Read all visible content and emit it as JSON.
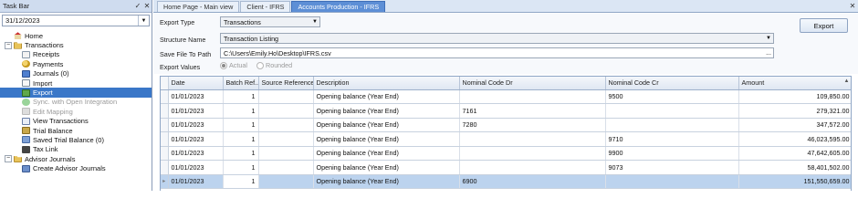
{
  "taskbar": {
    "title": "Task Bar",
    "pin_glyph": "✓",
    "close_glyph": "✕",
    "date_value": "31/12/2023",
    "tree": [
      {
        "label": "Home",
        "level": "l0noexp",
        "icon": "house",
        "expander": "",
        "state": ""
      },
      {
        "label": "Transactions",
        "level": "l0",
        "icon": "folder",
        "expander": "−",
        "state": ""
      },
      {
        "label": "Receipts",
        "level": "l1",
        "icon": "doc",
        "expander": "",
        "state": ""
      },
      {
        "label": "Payments",
        "level": "l1",
        "icon": "coins",
        "expander": "",
        "state": ""
      },
      {
        "label": "Journals (0)",
        "level": "l1",
        "icon": "journal",
        "expander": "",
        "state": ""
      },
      {
        "label": "Import",
        "level": "l1",
        "icon": "import",
        "expander": "",
        "state": ""
      },
      {
        "label": "Export",
        "level": "l1",
        "icon": "export",
        "expander": "",
        "state": "sel"
      },
      {
        "label": "Sync. with Open Integration",
        "level": "l1",
        "icon": "sync",
        "expander": "",
        "state": "dis"
      },
      {
        "label": "Edit Mapping",
        "level": "l1",
        "icon": "edit",
        "expander": "",
        "state": "dis"
      },
      {
        "label": "View Transactions",
        "level": "l1",
        "icon": "view",
        "expander": "",
        "state": ""
      },
      {
        "label": "Trial Balance",
        "level": "l1",
        "icon": "tb",
        "expander": "",
        "state": ""
      },
      {
        "label": "Saved Trial Balance (0)",
        "level": "l1",
        "icon": "saved",
        "expander": "",
        "state": ""
      },
      {
        "label": "Tax Link",
        "level": "l1",
        "icon": "taxlink",
        "expander": "",
        "state": ""
      },
      {
        "label": "Advisor Journals",
        "level": "l0",
        "icon": "folder",
        "expander": "−",
        "state": ""
      },
      {
        "label": "Create Advisor Journals",
        "level": "l1",
        "icon": "advisor",
        "expander": "",
        "state": ""
      }
    ]
  },
  "tabs": {
    "items": [
      "Home Page - Main view",
      "Client - IFRS",
      "Accounts Production - IFRS"
    ],
    "active_index": 2,
    "close_glyph": "✕"
  },
  "form": {
    "export_type_label": "Export Type",
    "export_type_value": "Transactions",
    "structure_name_label": "Structure Name",
    "structure_name_value": "Transaction Listing",
    "save_path_label": "Save File To Path",
    "save_path_value": "C:\\Users\\Emily.Ho\\Desktop\\IFRS.csv",
    "browse_glyph": "...",
    "export_values_label": "Export Values",
    "radio_actual": "Actual",
    "radio_rounded": "Rounded",
    "export_button": "Export"
  },
  "grid": {
    "columns": [
      "Date",
      "Batch Ref...",
      "Source Reference",
      "Description",
      "Nominal Code Dr",
      "Nominal Code Cr",
      "Amount"
    ],
    "rows": [
      [
        "01/01/2023",
        "1",
        "",
        "Opening balance (Year End)",
        "",
        "9500",
        "109,850.00"
      ],
      [
        "01/01/2023",
        "1",
        "",
        "Opening balance (Year End)",
        "7161",
        "",
        "279,321.00"
      ],
      [
        "01/01/2023",
        "1",
        "",
        "Opening balance (Year End)",
        "7280",
        "",
        "347,572.00"
      ],
      [
        "01/01/2023",
        "1",
        "",
        "Opening balance (Year End)",
        "",
        "9710",
        "46,023,595.00"
      ],
      [
        "01/01/2023",
        "1",
        "",
        "Opening balance (Year End)",
        "",
        "9900",
        "47,642,605.00"
      ],
      [
        "01/01/2023",
        "1",
        "",
        "Opening balance (Year End)",
        "",
        "9073",
        "58,401,502.00"
      ],
      [
        "01/01/2023",
        "1",
        "",
        "Opening balance (Year End)",
        "6900",
        "",
        "151,550,659.00"
      ]
    ],
    "selected_row": 6,
    "row_indicator": "▸"
  },
  "colors": {
    "accent": "#3a77c8",
    "tab_active": "#5d8fd6",
    "selected_row": "#bcd3ee"
  }
}
